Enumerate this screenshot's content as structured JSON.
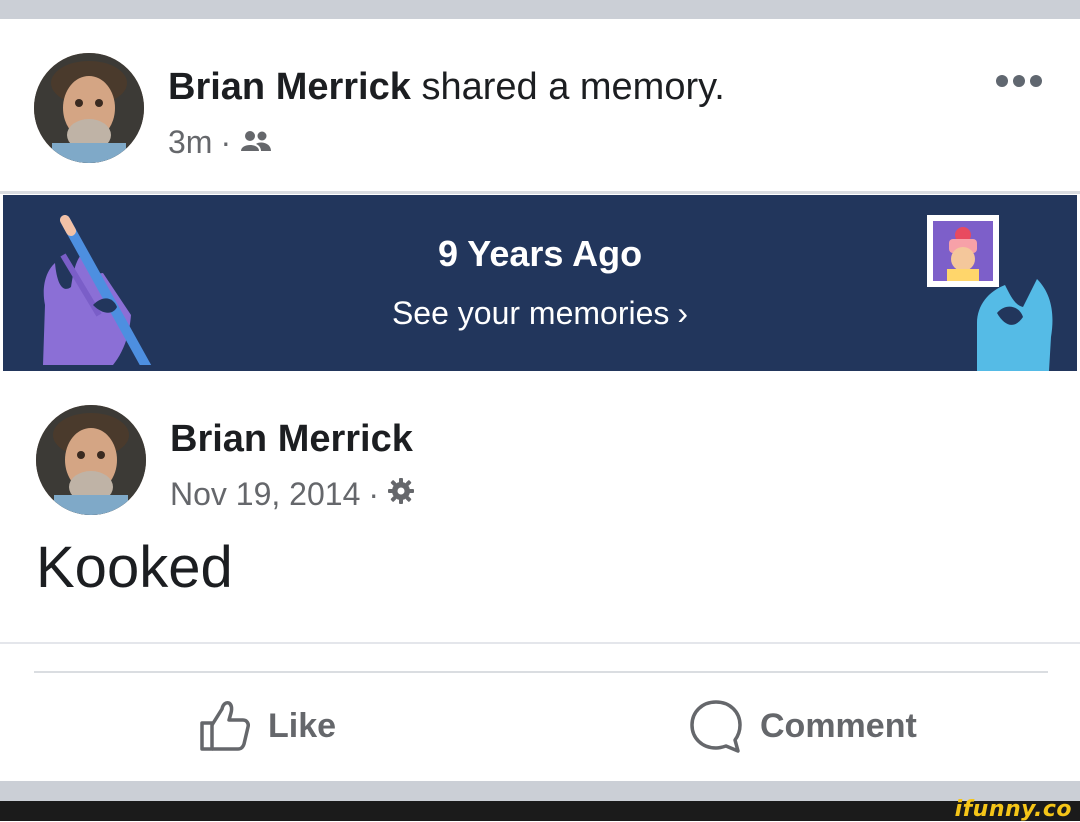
{
  "header": {
    "author_name": "Brian Merrick",
    "action_text": "shared a memory.",
    "timestamp": "3m",
    "separator": "·",
    "audience_icon": "friends-icon"
  },
  "more_icon": "more-horizontal-icon",
  "memory_banner": {
    "title": "9 Years Ago",
    "link_text": "See your memories",
    "link_chevron": "›"
  },
  "memory_post": {
    "author_name": "Brian Merrick",
    "date": "Nov 19, 2014",
    "separator": "·",
    "audience_icon": "custom-privacy-gear-icon",
    "text": "Kooked"
  },
  "actions": {
    "like_label": "Like",
    "like_icon": "thumbs-up-icon",
    "comment_label": "Comment",
    "comment_icon": "comment-bubble-icon"
  },
  "watermark": "ifunny.co",
  "colors": {
    "banner_bg": "#22365c",
    "text_primary": "#1c1e21",
    "text_secondary": "#65676b",
    "watermark": "#f5c518"
  }
}
